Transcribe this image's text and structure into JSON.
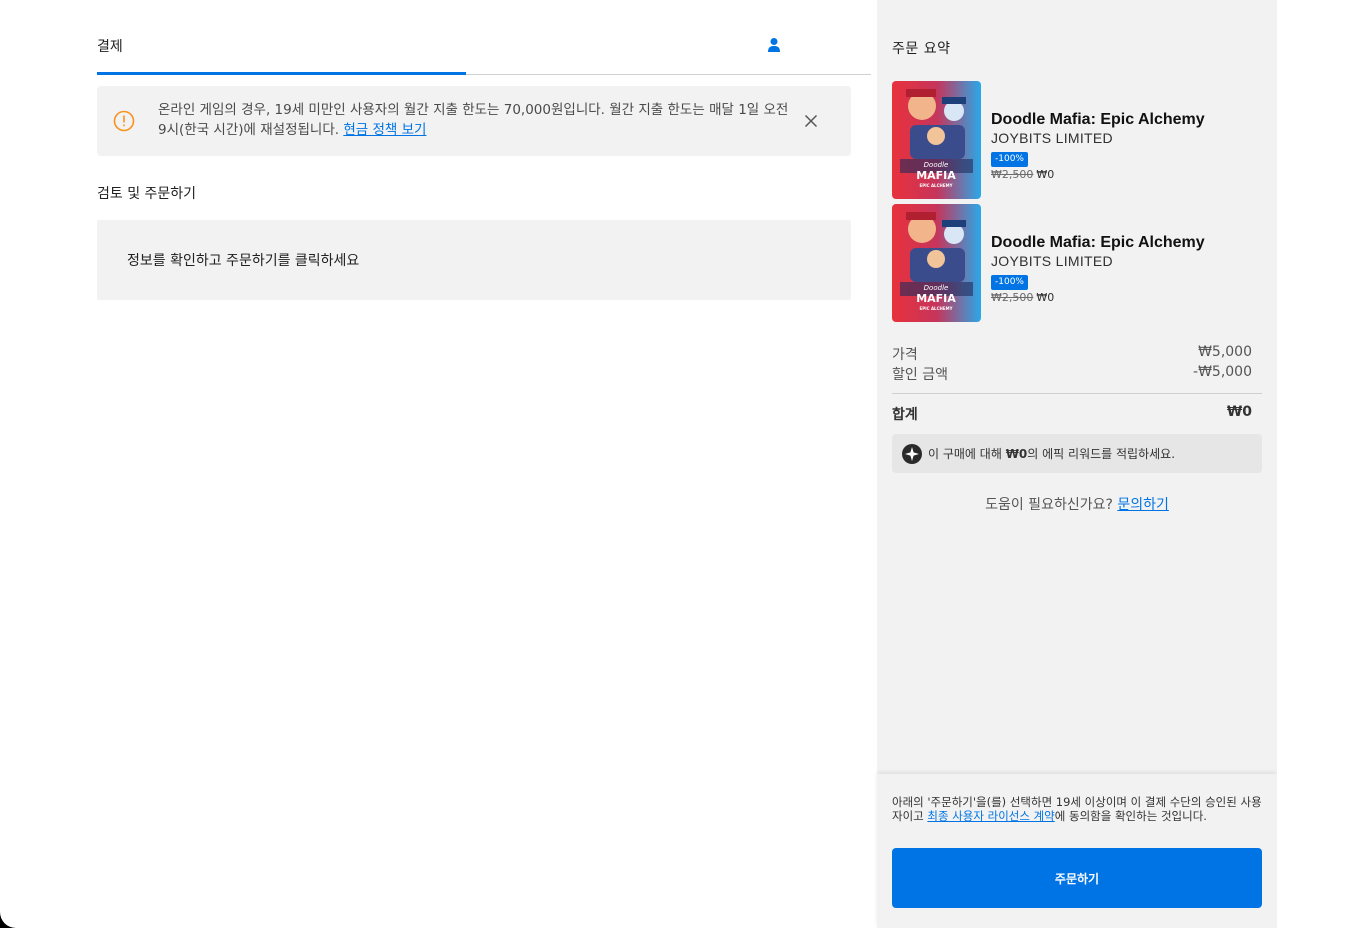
{
  "tabs": {
    "checkout_label": "결제"
  },
  "notice": {
    "text": "온라인 게임의 경우, 19세 미만인 사용자의 월간 지출 한도는 70,000원입니다. 월간 지출 한도는 매달 1일 오전 9시(한국 시간)에 재설정됩니다. ",
    "link": "현금 정책 보기",
    "accent": "#f7931e"
  },
  "review": {
    "title": "검토 및 주문하기",
    "message": "정보를 확인하고 주문하기를 클릭하세요"
  },
  "summary": {
    "title": "주문 요약",
    "items": [
      {
        "name": "Doodle Mafia: Epic Alchemy",
        "publisher": "JOYBITS LIMITED",
        "discount": "-100%",
        "original_price": "₩2,500",
        "price": "₩0",
        "thumb_title_1": "Doodle",
        "thumb_title_2": "MAFIA",
        "thumb_title_3": "EPIC ALCHEMY"
      },
      {
        "name": "Doodle Mafia: Epic Alchemy",
        "publisher": "JOYBITS LIMITED",
        "discount": "-100%",
        "original_price": "₩2,500",
        "price": "₩0",
        "thumb_title_1": "Doodle",
        "thumb_title_2": "MAFIA",
        "thumb_title_3": "EPIC ALCHEMY"
      }
    ],
    "price_label": "가격",
    "price_value": "₩5,000",
    "discount_label": "할인 금액",
    "discount_value": "-₩5,000",
    "total_label": "합계",
    "total_value": "₩0",
    "rewards_prefix": "이 구매에 대해 ",
    "rewards_amount": "₩0",
    "rewards_suffix": "의 에픽 리워드를 적립하세요.",
    "help_text": "도움이 필요하신가요? ",
    "help_link": "문의하기"
  },
  "footer": {
    "legal_prefix": "아래의 '주문하기'을(를) 선택하면 19세 이상이며 이 결제 수단의 승인된 사용자이고 ",
    "legal_link": "최종 사용자 라이선스 계약",
    "legal_suffix": "에 동의함을 확인하는 것입니다.",
    "order_button": "주문하기"
  },
  "colors": {
    "accent": "#0074e4",
    "panel": "#f2f2f2"
  }
}
